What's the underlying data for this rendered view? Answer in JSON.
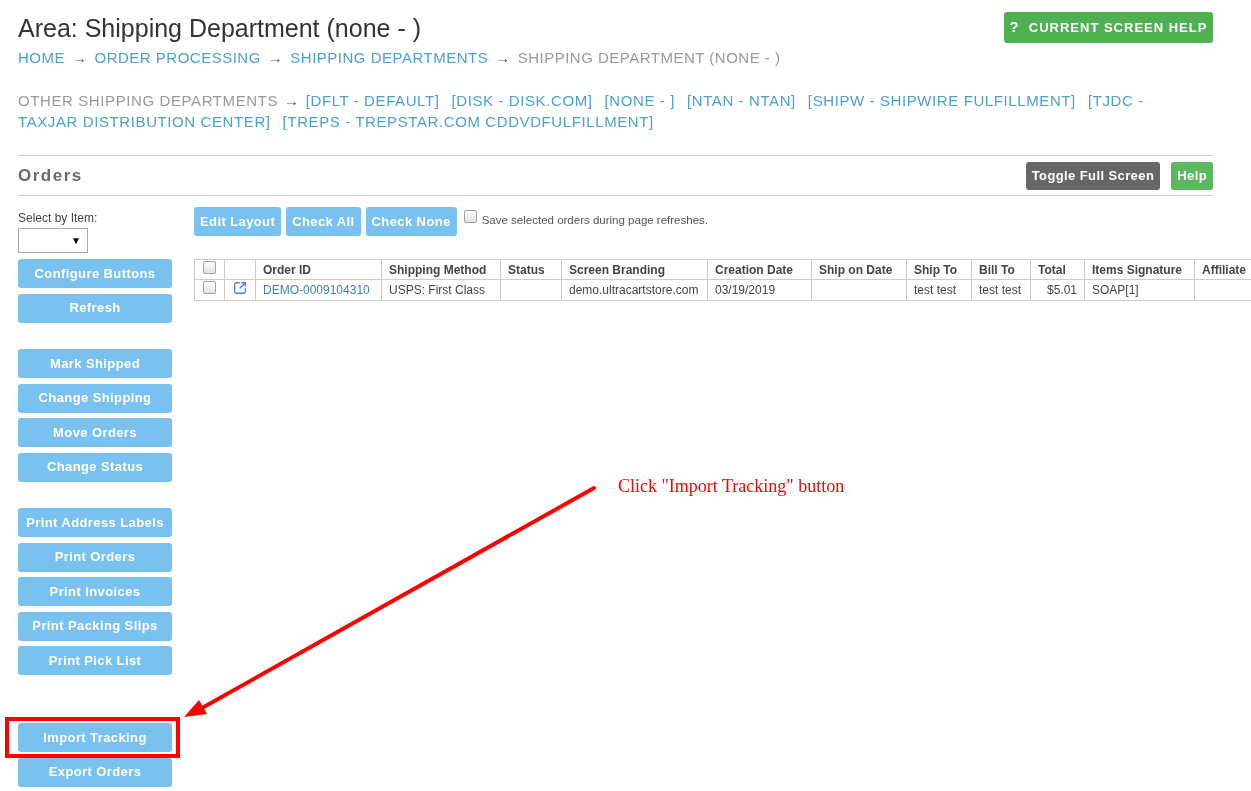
{
  "header": {
    "title": "Area: Shipping Department (none - )",
    "help_button": {
      "icon": "?",
      "label": "CURRENT SCREEN HELP"
    }
  },
  "breadcrumb": [
    {
      "label": "HOME",
      "link": true,
      "separator": "→"
    },
    {
      "label": "ORDER PROCESSING",
      "link": true,
      "separator": "→"
    },
    {
      "label": "SHIPPING DEPARTMENTS",
      "link": true,
      "separator": "→"
    },
    {
      "label": "SHIPPING DEPARTMENT (NONE - )",
      "link": false
    }
  ],
  "other_departments": {
    "label": "OTHER SHIPPING DEPARTMENTS",
    "separator": "→",
    "items": [
      "[DFLT - DEFAULT]",
      "[DISK - DISK.COM]",
      "[NONE - ]",
      "[NTAN - NTAN]",
      "[SHIPW - SHIPWIRE FULFILLMENT]",
      "[TJDC -",
      "TAXJAR DISTRIBUTION CENTER]",
      "[TREPS - TREPSTAR.COM CDDVDFULFILLMENT]"
    ]
  },
  "orders": {
    "title": "Orders",
    "buttons": [
      {
        "label": "Toggle Full Screen",
        "kind": "dark"
      },
      {
        "label": "Help",
        "kind": "green"
      }
    ]
  },
  "sidebar": {
    "select_label": "Select by Item:",
    "select": {
      "arrow": "▼"
    },
    "button_groups": [
      [
        {
          "label": "Configure Buttons",
          "highlighted": false
        },
        {
          "label": "Refresh",
          "highlighted": false
        }
      ],
      [
        {
          "label": "Mark Shipped",
          "highlighted": false
        },
        {
          "label": "Change Shipping",
          "highlighted": false
        },
        {
          "label": "Move Orders",
          "highlighted": false
        },
        {
          "label": "Change Status",
          "highlighted": false
        }
      ],
      [
        {
          "label": "Print Address Labels",
          "highlighted": false
        },
        {
          "label": "Print Orders",
          "highlighted": false
        },
        {
          "label": "Print Invoices",
          "highlighted": false
        },
        {
          "label": "Print Packing Slips",
          "highlighted": false
        },
        {
          "label": "Print Pick List",
          "highlighted": false
        }
      ],
      [
        {
          "label": "Import Tracking",
          "highlighted": true
        },
        {
          "label": "Export Orders",
          "highlighted": false
        }
      ]
    ]
  },
  "toolbar": {
    "buttons": [
      "Edit Layout",
      "Check All",
      "Check None"
    ],
    "save_selected": {
      "label": "Save selected orders during page refreshes.",
      "checked": false
    }
  },
  "table": {
    "columns": [
      {
        "kind": "checkbox",
        "checked": false
      },
      {
        "kind": "blank"
      },
      {
        "kind": "text",
        "label": "Order ID"
      },
      {
        "kind": "text",
        "label": "Shipping Method"
      },
      {
        "kind": "text",
        "label": "Status"
      },
      {
        "kind": "text",
        "label": "Screen Branding"
      },
      {
        "kind": "text",
        "label": "Creation Date"
      },
      {
        "kind": "text",
        "label": "Ship on Date"
      },
      {
        "kind": "text",
        "label": "Ship To"
      },
      {
        "kind": "text",
        "label": "Bill To"
      },
      {
        "kind": "amount",
        "label": "Total"
      },
      {
        "kind": "text",
        "label": "Items Signature"
      },
      {
        "kind": "text",
        "label": "Affiliate"
      }
    ],
    "rows": [
      {
        "cells": [
          {
            "checked": false
          },
          {},
          {
            "text": "DEMO-0009104310",
            "link": true
          },
          "USPS: First Class",
          "",
          "demo.ultracartstore.com",
          "03/19/2019",
          "",
          "test test",
          "test test",
          "$5.01",
          "SOAP[1]",
          ""
        ]
      }
    ]
  },
  "annotation": {
    "text": "Click \"Import Tracking\" button"
  }
}
